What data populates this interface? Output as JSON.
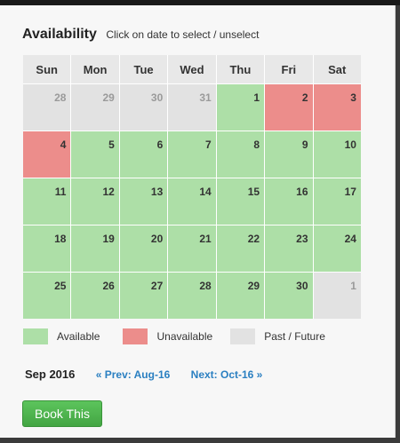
{
  "header": {
    "title": "Availability",
    "subtitle": "Click on date to select / unselect"
  },
  "calendar": {
    "days_of_week": [
      "Sun",
      "Mon",
      "Tue",
      "Wed",
      "Thu",
      "Fri",
      "Sat"
    ],
    "weeks": [
      [
        {
          "day": "28",
          "status": "past"
        },
        {
          "day": "29",
          "status": "past"
        },
        {
          "day": "30",
          "status": "past"
        },
        {
          "day": "31",
          "status": "past"
        },
        {
          "day": "1",
          "status": "available"
        },
        {
          "day": "2",
          "status": "unavailable"
        },
        {
          "day": "3",
          "status": "unavailable"
        }
      ],
      [
        {
          "day": "4",
          "status": "unavailable"
        },
        {
          "day": "5",
          "status": "available"
        },
        {
          "day": "6",
          "status": "available"
        },
        {
          "day": "7",
          "status": "available"
        },
        {
          "day": "8",
          "status": "available"
        },
        {
          "day": "9",
          "status": "available"
        },
        {
          "day": "10",
          "status": "available"
        }
      ],
      [
        {
          "day": "11",
          "status": "available"
        },
        {
          "day": "12",
          "status": "available"
        },
        {
          "day": "13",
          "status": "available"
        },
        {
          "day": "14",
          "status": "available"
        },
        {
          "day": "15",
          "status": "available"
        },
        {
          "day": "16",
          "status": "available"
        },
        {
          "day": "17",
          "status": "available"
        }
      ],
      [
        {
          "day": "18",
          "status": "available"
        },
        {
          "day": "19",
          "status": "available"
        },
        {
          "day": "20",
          "status": "available"
        },
        {
          "day": "21",
          "status": "available"
        },
        {
          "day": "22",
          "status": "available"
        },
        {
          "day": "23",
          "status": "available"
        },
        {
          "day": "24",
          "status": "available"
        }
      ],
      [
        {
          "day": "25",
          "status": "available"
        },
        {
          "day": "26",
          "status": "available"
        },
        {
          "day": "27",
          "status": "available"
        },
        {
          "day": "28",
          "status": "available"
        },
        {
          "day": "29",
          "status": "available"
        },
        {
          "day": "30",
          "status": "available"
        },
        {
          "day": "1",
          "status": "past"
        }
      ]
    ]
  },
  "legend": {
    "available": {
      "label": "Available",
      "color": "#addfa7"
    },
    "unavailable": {
      "label": "Unavailable",
      "color": "#ec8d8b"
    },
    "past": {
      "label": "Past / Future",
      "color": "#e2e2e2"
    }
  },
  "nav": {
    "current_month": "Sep 2016",
    "prev_label": "« Prev: Aug-16",
    "next_label": "Next: Oct-16 »"
  },
  "actions": {
    "book_label": "Book This"
  }
}
